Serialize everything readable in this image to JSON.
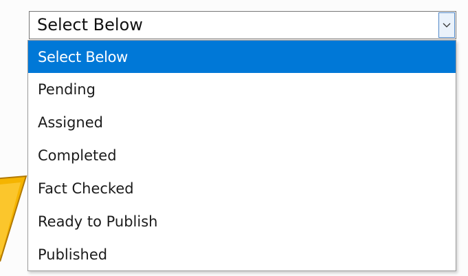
{
  "select": {
    "value": "Select Below",
    "toggle_icon": "chevron-down-icon"
  },
  "dropdown": {
    "options": [
      {
        "label": "Select Below",
        "selected": true
      },
      {
        "label": "Pending",
        "selected": false
      },
      {
        "label": "Assigned",
        "selected": false
      },
      {
        "label": "Completed",
        "selected": false
      },
      {
        "label": "Fact Checked",
        "selected": false
      },
      {
        "label": "Ready to Publish",
        "selected": false
      },
      {
        "label": "Published",
        "selected": false
      }
    ]
  },
  "colors": {
    "highlight": "#0078d7",
    "arrow": "#f5b400",
    "arrow_outline": "#b07800"
  }
}
